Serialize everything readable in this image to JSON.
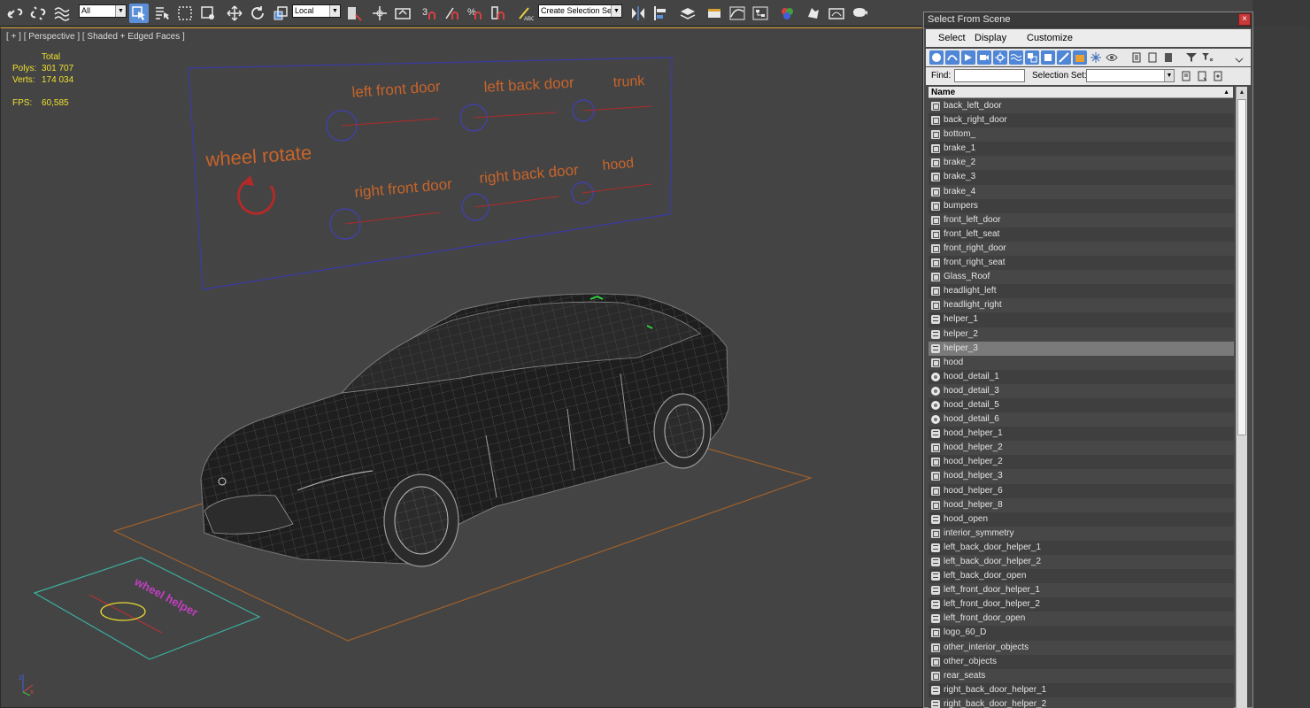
{
  "toolbar": {
    "filter_value": "All",
    "coord_value": "Local",
    "selection_set_placeholder": "Create Selection Se"
  },
  "viewport": {
    "label": "[ + ] [ Perspective ] [ Shaded + Edged Faces ]",
    "stats": {
      "total_label": "Total",
      "polys_label": "Polys:",
      "polys_value": "301 707",
      "verts_label": "Verts:",
      "verts_value": "174 034",
      "fps_label": "FPS:",
      "fps_value": "60,585"
    },
    "control_board": {
      "wheel_rotate": "wheel rotate",
      "left_front_door": "left front door",
      "left_back_door": "left back door",
      "trunk": "trunk",
      "right_front_door": "right front door",
      "right_back_door": "right back door",
      "hood": "hood"
    },
    "ground_helper_text": "wheel helper",
    "axis_x": "x",
    "axis_z": "z"
  },
  "dialog": {
    "title": "Select From Scene",
    "close_glyph": "×",
    "menu": {
      "select": "Select",
      "display": "Display",
      "customize": "Customize"
    },
    "find_label": "Find:",
    "selection_set_label": "Selection Set:",
    "column_name": "Name",
    "objects": [
      {
        "name": "back_left_door",
        "type": "obj"
      },
      {
        "name": "back_right_door",
        "type": "obj"
      },
      {
        "name": "bottom_",
        "type": "obj"
      },
      {
        "name": "brake_1",
        "type": "obj"
      },
      {
        "name": "brake_2",
        "type": "obj"
      },
      {
        "name": "brake_3",
        "type": "obj"
      },
      {
        "name": "brake_4",
        "type": "obj"
      },
      {
        "name": "bumpers",
        "type": "obj"
      },
      {
        "name": "front_left_door",
        "type": "obj"
      },
      {
        "name": "front_left_seat",
        "type": "obj"
      },
      {
        "name": "front_right_door",
        "type": "obj"
      },
      {
        "name": "front_right_seat",
        "type": "obj"
      },
      {
        "name": "Glass_Roof",
        "type": "obj"
      },
      {
        "name": "headlight_left",
        "type": "obj"
      },
      {
        "name": "headlight_right",
        "type": "obj"
      },
      {
        "name": "helper_1",
        "type": "shape"
      },
      {
        "name": "helper_2",
        "type": "shape"
      },
      {
        "name": "helper_3",
        "type": "shape",
        "selected": true
      },
      {
        "name": "hood",
        "type": "obj"
      },
      {
        "name": "hood_detail_1",
        "type": "helper"
      },
      {
        "name": "hood_detail_3",
        "type": "helper"
      },
      {
        "name": "hood_detail_5",
        "type": "helper"
      },
      {
        "name": "hood_detail_6",
        "type": "helper"
      },
      {
        "name": "hood_helper_1",
        "type": "shape"
      },
      {
        "name": "hood_helper_2",
        "type": "obj"
      },
      {
        "name": "hood_helper_2",
        "type": "obj"
      },
      {
        "name": "hood_helper_3",
        "type": "obj"
      },
      {
        "name": "hood_helper_6",
        "type": "obj"
      },
      {
        "name": "hood_helper_8",
        "type": "obj"
      },
      {
        "name": "hood_open",
        "type": "shape"
      },
      {
        "name": "interior_symmetry",
        "type": "obj"
      },
      {
        "name": "left_back_door_helper_1",
        "type": "shape"
      },
      {
        "name": "left_back_door_helper_2",
        "type": "shape"
      },
      {
        "name": "left_back_door_open",
        "type": "shape"
      },
      {
        "name": "left_front_door_helper_1",
        "type": "shape"
      },
      {
        "name": "left_front_door_helper_2",
        "type": "shape"
      },
      {
        "name": "left_front_door_open",
        "type": "shape"
      },
      {
        "name": "logo_60_D",
        "type": "obj"
      },
      {
        "name": "other_interior_objects",
        "type": "obj"
      },
      {
        "name": "other_objects",
        "type": "obj"
      },
      {
        "name": "rear_seats",
        "type": "obj"
      },
      {
        "name": "right_back_door_helper_1",
        "type": "shape"
      },
      {
        "name": "right_back_door_helper_2",
        "type": "shape"
      }
    ]
  },
  "colors": {
    "accent_blue": "#5b8fd8",
    "board_text": "#c8642a",
    "board_frame": "#3a3aa8",
    "ground_plane": "#a0602a",
    "helper_plane": "#3ab0a0",
    "stats_text": "#f0e030"
  }
}
